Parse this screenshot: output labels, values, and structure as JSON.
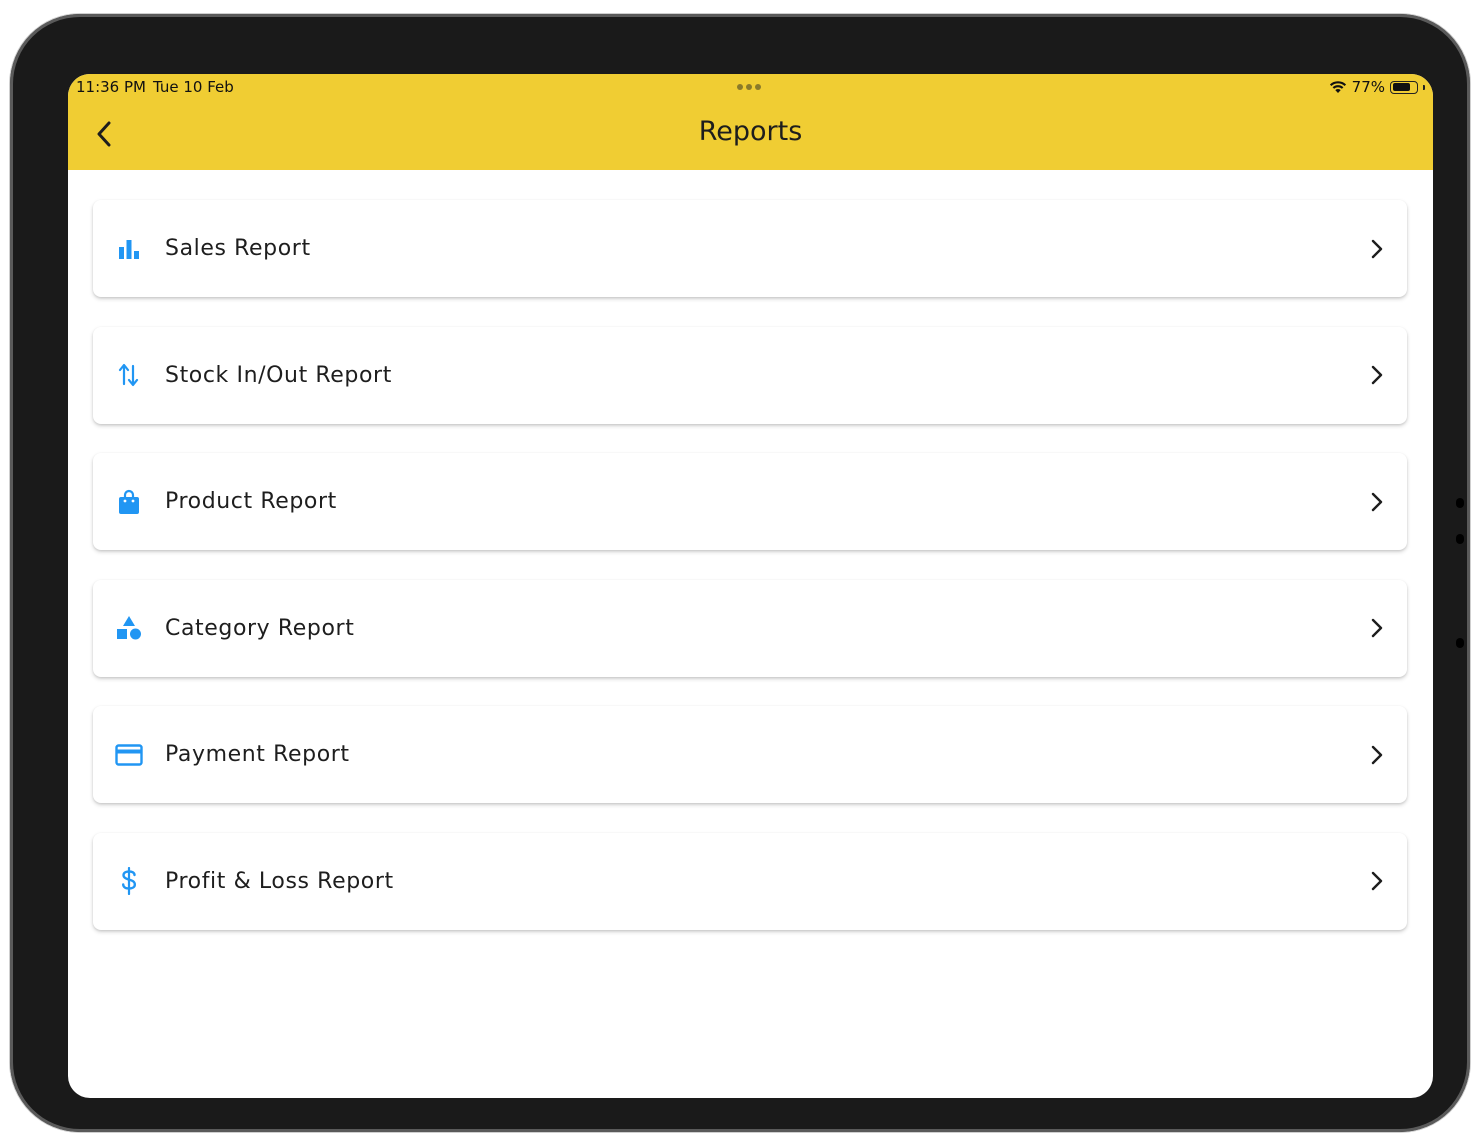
{
  "status_bar": {
    "time": "11:36 PM",
    "date": "Tue 10 Feb",
    "battery": "77%",
    "battery_level": 0.77
  },
  "appbar": {
    "title": "Reports",
    "background_color": "#f0cd33"
  },
  "accent_color": "#2196f3",
  "reports": [
    {
      "label": "Sales Report",
      "icon": "bar-chart-icon"
    },
    {
      "label": "Stock In/Out Report",
      "icon": "swap-vertical-icon"
    },
    {
      "label": "Product Report",
      "icon": "shopping-bag-icon"
    },
    {
      "label": "Category Report",
      "icon": "category-shapes-icon"
    },
    {
      "label": "Payment Report",
      "icon": "credit-card-icon"
    },
    {
      "label": "Profit & Loss Report",
      "icon": "dollar-icon"
    }
  ]
}
